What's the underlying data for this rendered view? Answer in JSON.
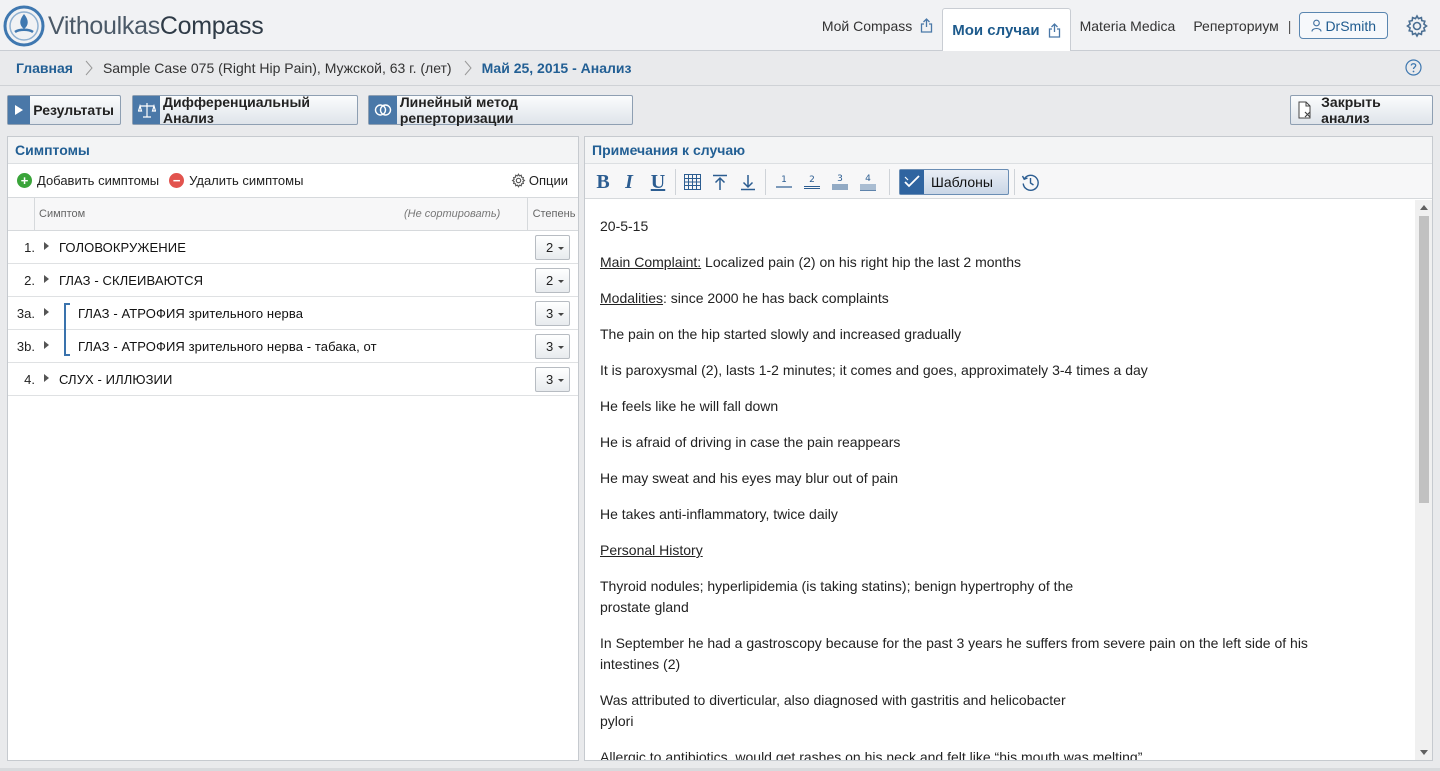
{
  "brand": {
    "part1": "Vithoulkas",
    "part2": "Compass"
  },
  "nav": {
    "my_compass": "Мой Compass",
    "my_cases": "Мои случаи",
    "materia_medica": "Materia Medica",
    "repertory": "Реперториум",
    "separator": "|",
    "user": "DrSmith"
  },
  "breadcrumb": {
    "home": "Главная",
    "case": "Sample Case 075 (Right Hip Pain), Мужской, 63 г. (лет)",
    "analysis": "Май 25, 2015 - Анализ"
  },
  "actions": {
    "results": "Результаты",
    "differential": "Дифференциальный Анализ",
    "linear": "Линейный метод реперторизации",
    "close": "Закрыть анализ"
  },
  "symptoms_panel": {
    "title": "Симптомы",
    "add": "Добавить симптомы",
    "remove": "Удалить симптомы",
    "options": "Опции",
    "col_symptom": "Симптом",
    "col_sort": "(Не сортировать)",
    "col_degree": "Степень",
    "rows": [
      {
        "num": "1.",
        "text": "ГОЛОВОКРУЖЕНИЕ",
        "degree": "2"
      },
      {
        "num": "2.",
        "text": "ГЛАЗ - СКЛЕИВАЮТСЯ",
        "degree": "2"
      },
      {
        "num": "3a.",
        "text": "ГЛАЗ - АТРОФИЯ зрительного нерва",
        "degree": "3"
      },
      {
        "num": "3b.",
        "text": "ГЛАЗ - АТРОФИЯ зрительного нерва - табака, от",
        "degree": "3"
      },
      {
        "num": "4.",
        "text": "СЛУХ - ИЛЛЮЗИИ",
        "degree": "3"
      }
    ]
  },
  "notes_panel": {
    "title": "Примечания к случаю",
    "templates": "Шаблоны",
    "format": {
      "bold": "B",
      "italic": "I",
      "underline": "U"
    },
    "headings": [
      "1",
      "2",
      "3",
      "4"
    ],
    "notes": {
      "date": "20-5-15",
      "main_label": "Main Complaint:",
      "main_text": " Localized pain (2) on his right hip the last 2 months",
      "mod_label": "Modalities",
      "mod_text": ": since 2000 he has back complaints",
      "l1": "The pain on the hip started slowly and increased gradually",
      "l2": "It is paroxysmal (2), lasts 1-2 minutes; it comes and goes, approximately 3-4 times a day",
      "l3": "He feels like he will fall down",
      "l4": "He is afraid of driving in case the pain reappears",
      "l5": "He may sweat and his eyes may blur out of pain",
      "l6": "He takes anti-inflammatory, twice daily",
      "ph_label": "Personal History",
      "l7a": "Thyroid nodules; hyperlipidemia (is taking statins); benign hypertrophy of the",
      "l7b": "prostate gland",
      "l8a": "In September he had a gastroscopy because for the past 3 years he suffers from severe pain on the left side of his",
      "l8b": "intestines (2)",
      "l9a": "Was attributed to diverticular, also diagnosed with gastritis and helicobacter",
      "l9b": "pylori",
      "l10": "Allergic to antibiotics, would get rashes on his neck and felt like “his mouth was melting”"
    }
  },
  "colors": {
    "accent": "#225f94",
    "button_icon": "#4a78a8",
    "add": "#3aa43a",
    "remove": "#e2534e"
  }
}
